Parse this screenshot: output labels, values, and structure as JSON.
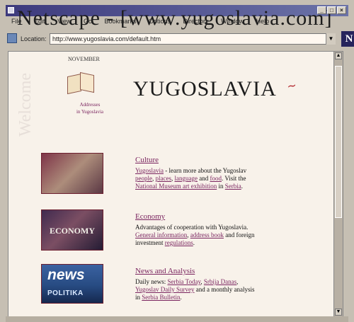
{
  "window": {
    "title": "Netscape - [www.yugoslavia.com]"
  },
  "menu": [
    "File",
    "Edit",
    "View",
    "Go",
    "Bookmarks",
    "Options",
    "Directory",
    "Window",
    "Help"
  ],
  "location": {
    "label": "Location:",
    "url": "http://www.yugoslavia.com/default.htm"
  },
  "page": {
    "header_small": "NOVEMBER",
    "title": "YUGOSLAVIA",
    "addresses": [
      "Addresses",
      "in Yugoslavia"
    ],
    "sections": [
      {
        "heading": "Culture",
        "lines": [
          [
            {
              "t": "Yugoslavia",
              "link": true
            },
            {
              "t": " - learn more about the Yugoslav",
              "link": false
            }
          ],
          [
            {
              "t": "people",
              "link": true
            },
            {
              "t": ", ",
              "link": false
            },
            {
              "t": "places",
              "link": true
            },
            {
              "t": ", ",
              "link": false
            },
            {
              "t": "language",
              "link": true
            },
            {
              "t": " and ",
              "link": false
            },
            {
              "t": "food",
              "link": true
            },
            {
              "t": ". Visit the",
              "link": false
            }
          ],
          [
            {
              "t": "National Museum art exhibition",
              "link": true
            },
            {
              "t": " in ",
              "link": false
            },
            {
              "t": "Serbia",
              "link": true
            },
            {
              "t": ".",
              "link": false
            }
          ]
        ]
      },
      {
        "heading": "Economy",
        "lines": [
          [
            {
              "t": "Advantages of cooperation with Yugoslavia.",
              "link": false
            }
          ],
          [
            {
              "t": "General information",
              "link": true
            },
            {
              "t": ", ",
              "link": false
            },
            {
              "t": "address book",
              "link": true
            },
            {
              "t": " and foreign",
              "link": false
            }
          ],
          [
            {
              "t": "investment ",
              "link": false
            },
            {
              "t": "regulations",
              "link": true
            },
            {
              "t": ".",
              "link": false
            }
          ]
        ]
      },
      {
        "heading": "News and Analysis",
        "lines": [
          [
            {
              "t": "Daily news: ",
              "link": false
            },
            {
              "t": "Serbia Today",
              "link": true
            },
            {
              "t": ", ",
              "link": false
            },
            {
              "t": "Srbija Danas",
              "link": true
            },
            {
              "t": ",",
              "link": false
            }
          ],
          [
            {
              "t": "Yugoslav Daily Survey",
              "link": true
            },
            {
              "t": " and a monthly analysis",
              "link": false
            }
          ],
          [
            {
              "t": "in ",
              "link": false
            },
            {
              "t": "Serbia Bulletin",
              "link": true
            },
            {
              "t": ".",
              "link": false
            }
          ]
        ]
      }
    ],
    "images": {
      "economy": "ECONOMY",
      "news": "news",
      "news_sub": "POLITIKA"
    }
  }
}
